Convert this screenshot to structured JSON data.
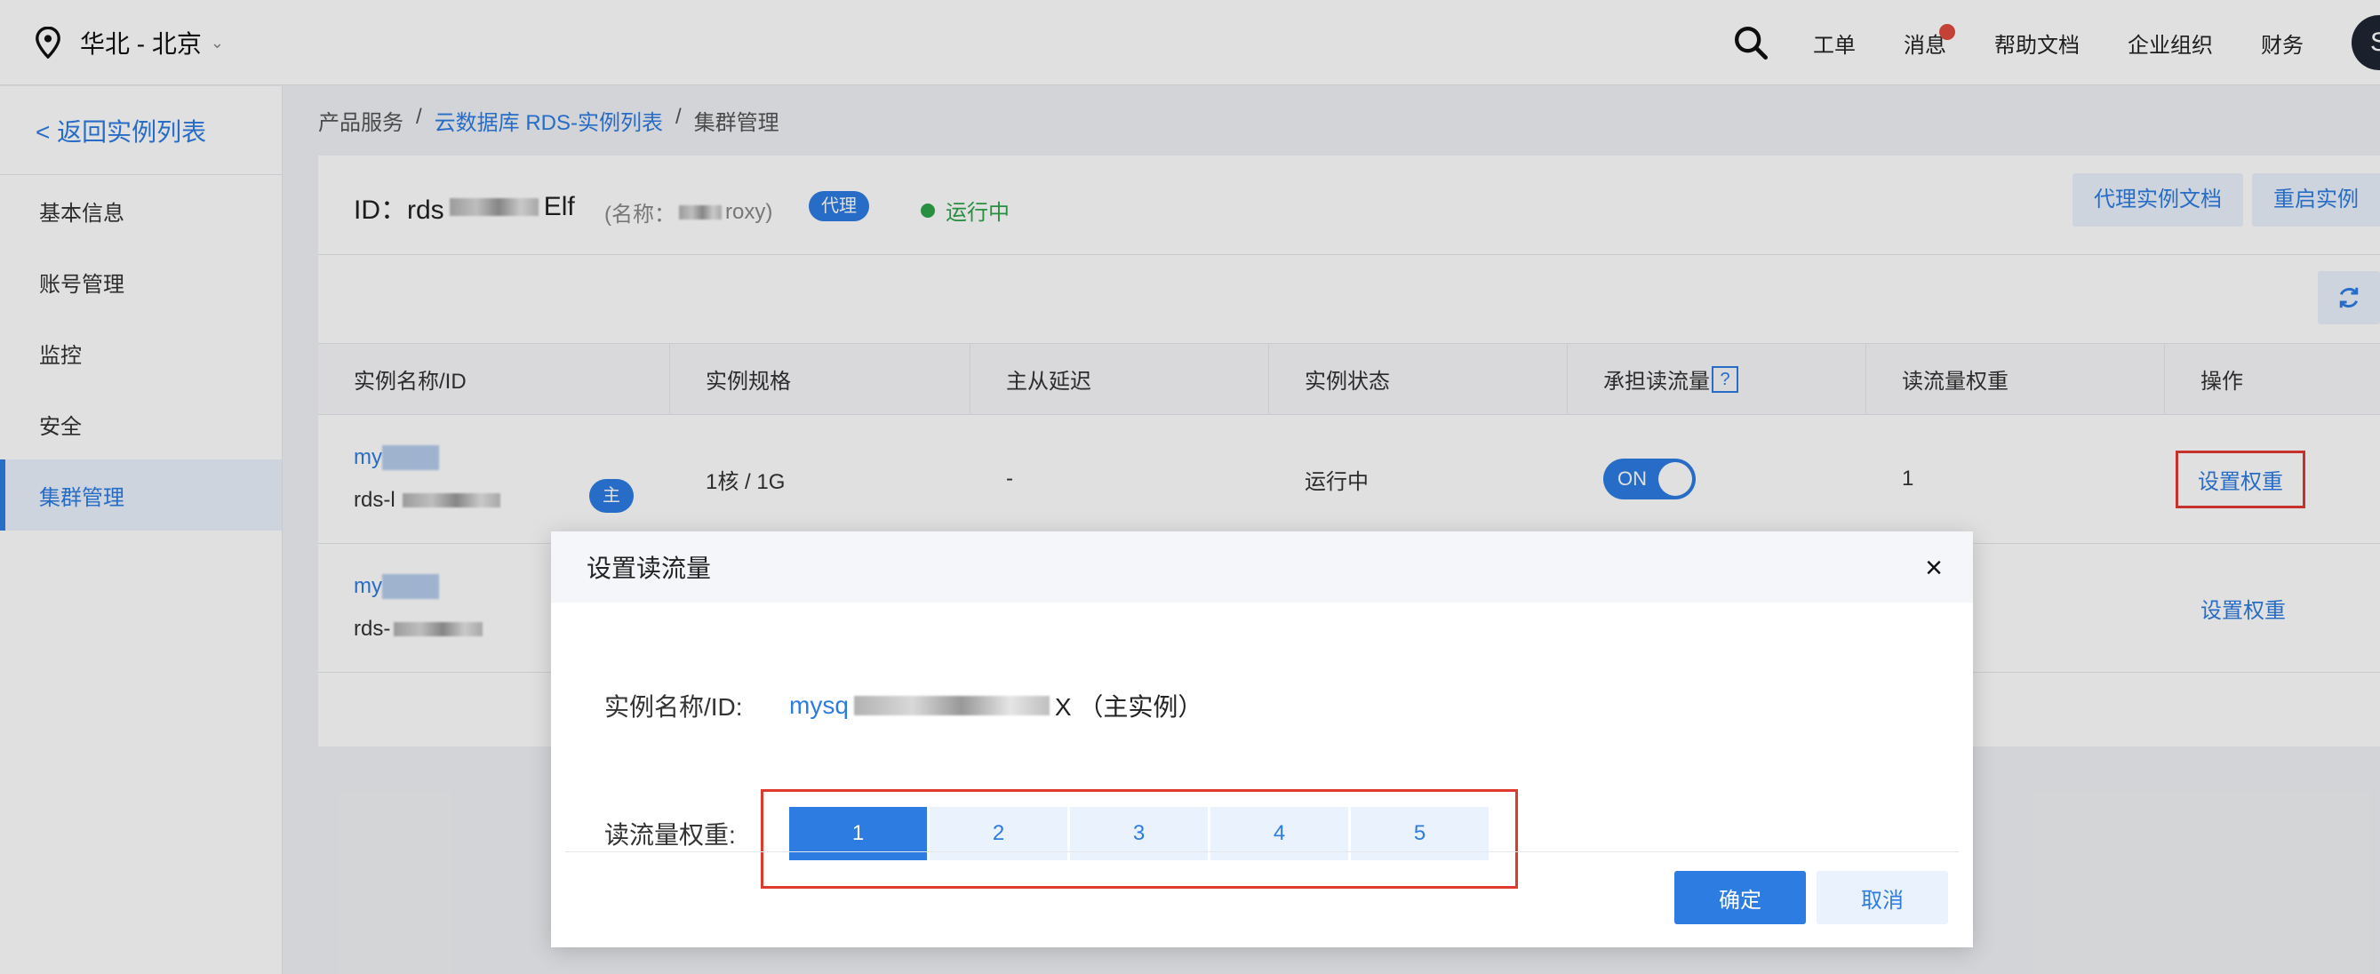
{
  "topbar": {
    "region": "华北 - 北京",
    "nav": [
      "工单",
      "消息",
      "帮助文档",
      "企业组织",
      "财务"
    ],
    "avatar": "S"
  },
  "sidebar": {
    "back": "< 返回实例列表",
    "items": [
      "基本信息",
      "账号管理",
      "监控",
      "安全",
      "集群管理"
    ],
    "active_index": 4
  },
  "breadcrumb": {
    "items": [
      "产品服务",
      "云数据库 RDS-实例列表",
      "集群管理"
    ],
    "sep": "/"
  },
  "instance": {
    "id_label": "ID：rds",
    "id_suffix": "Elf",
    "name_prefix": "(名称：",
    "name_suffix": "roxy)",
    "tag": "代理",
    "status": "运行中",
    "buttons": [
      "代理实例文档",
      "重启实例"
    ]
  },
  "table": {
    "headers": [
      "实例名称/ID",
      "实例规格",
      "主从延迟",
      "实例状态",
      "承担读流量",
      "读流量权重",
      "操作"
    ],
    "help_mark": "?",
    "rows": [
      {
        "name": "my",
        "id": "rds-l",
        "role": "主",
        "spec": "1核 / 1G",
        "delay": "-",
        "state": "运行中",
        "read": "ON",
        "weight": "1",
        "op": "设置权重"
      },
      {
        "name": "my",
        "id": "rds-",
        "op": "设置权重"
      }
    ]
  },
  "modal": {
    "title": "设置读流量",
    "close": "×",
    "instance_label": "实例名称/ID:",
    "instance_prefix": "mysq",
    "instance_suffix": "X （主实例）",
    "weight_label": "读流量权重:",
    "weights": [
      "1",
      "2",
      "3",
      "4",
      "5"
    ],
    "selected_weight": "1",
    "ok": "确定",
    "cancel": "取消"
  },
  "colors": {
    "accent": "#2d7ce2",
    "highlight": "#e03a2f",
    "running": "#2ea34b"
  }
}
